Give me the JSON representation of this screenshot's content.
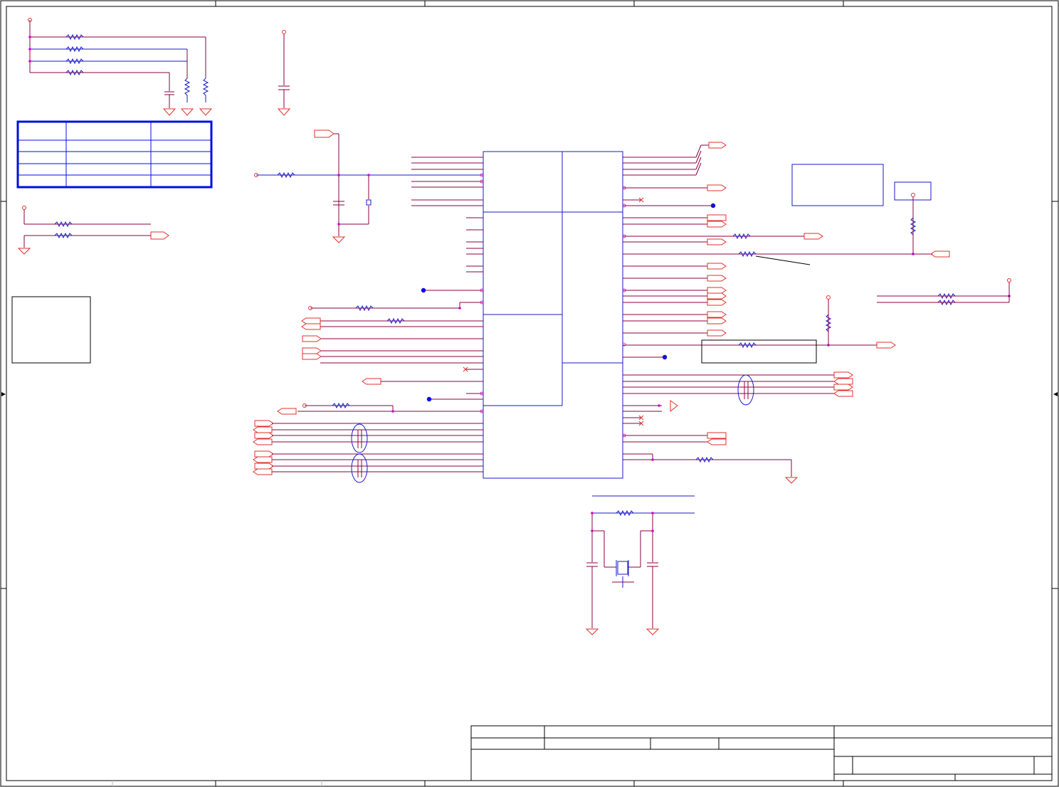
{
  "sheet": {
    "colors": {
      "wire": "#8b0040",
      "component": "#e0302a",
      "body": "#1a1acc",
      "node": "#d400d4",
      "frame": "#000000",
      "table_border": "#0010e0",
      "background": "#ffffff"
    },
    "title_block": {
      "title": "",
      "size": "",
      "document_number": "",
      "revision": "",
      "date": "",
      "sheet": ""
    }
  },
  "strap_table": {
    "headers": [
      "",
      "",
      ""
    ],
    "rows": [
      [
        "",
        "",
        ""
      ],
      [
        "",
        "",
        ""
      ],
      [
        "",
        "",
        ""
      ],
      [
        "",
        "",
        ""
      ]
    ]
  },
  "main_ic": {
    "reference": "",
    "value": ""
  },
  "notes": {
    "note_box": "",
    "left_box": "",
    "label_box": ""
  }
}
